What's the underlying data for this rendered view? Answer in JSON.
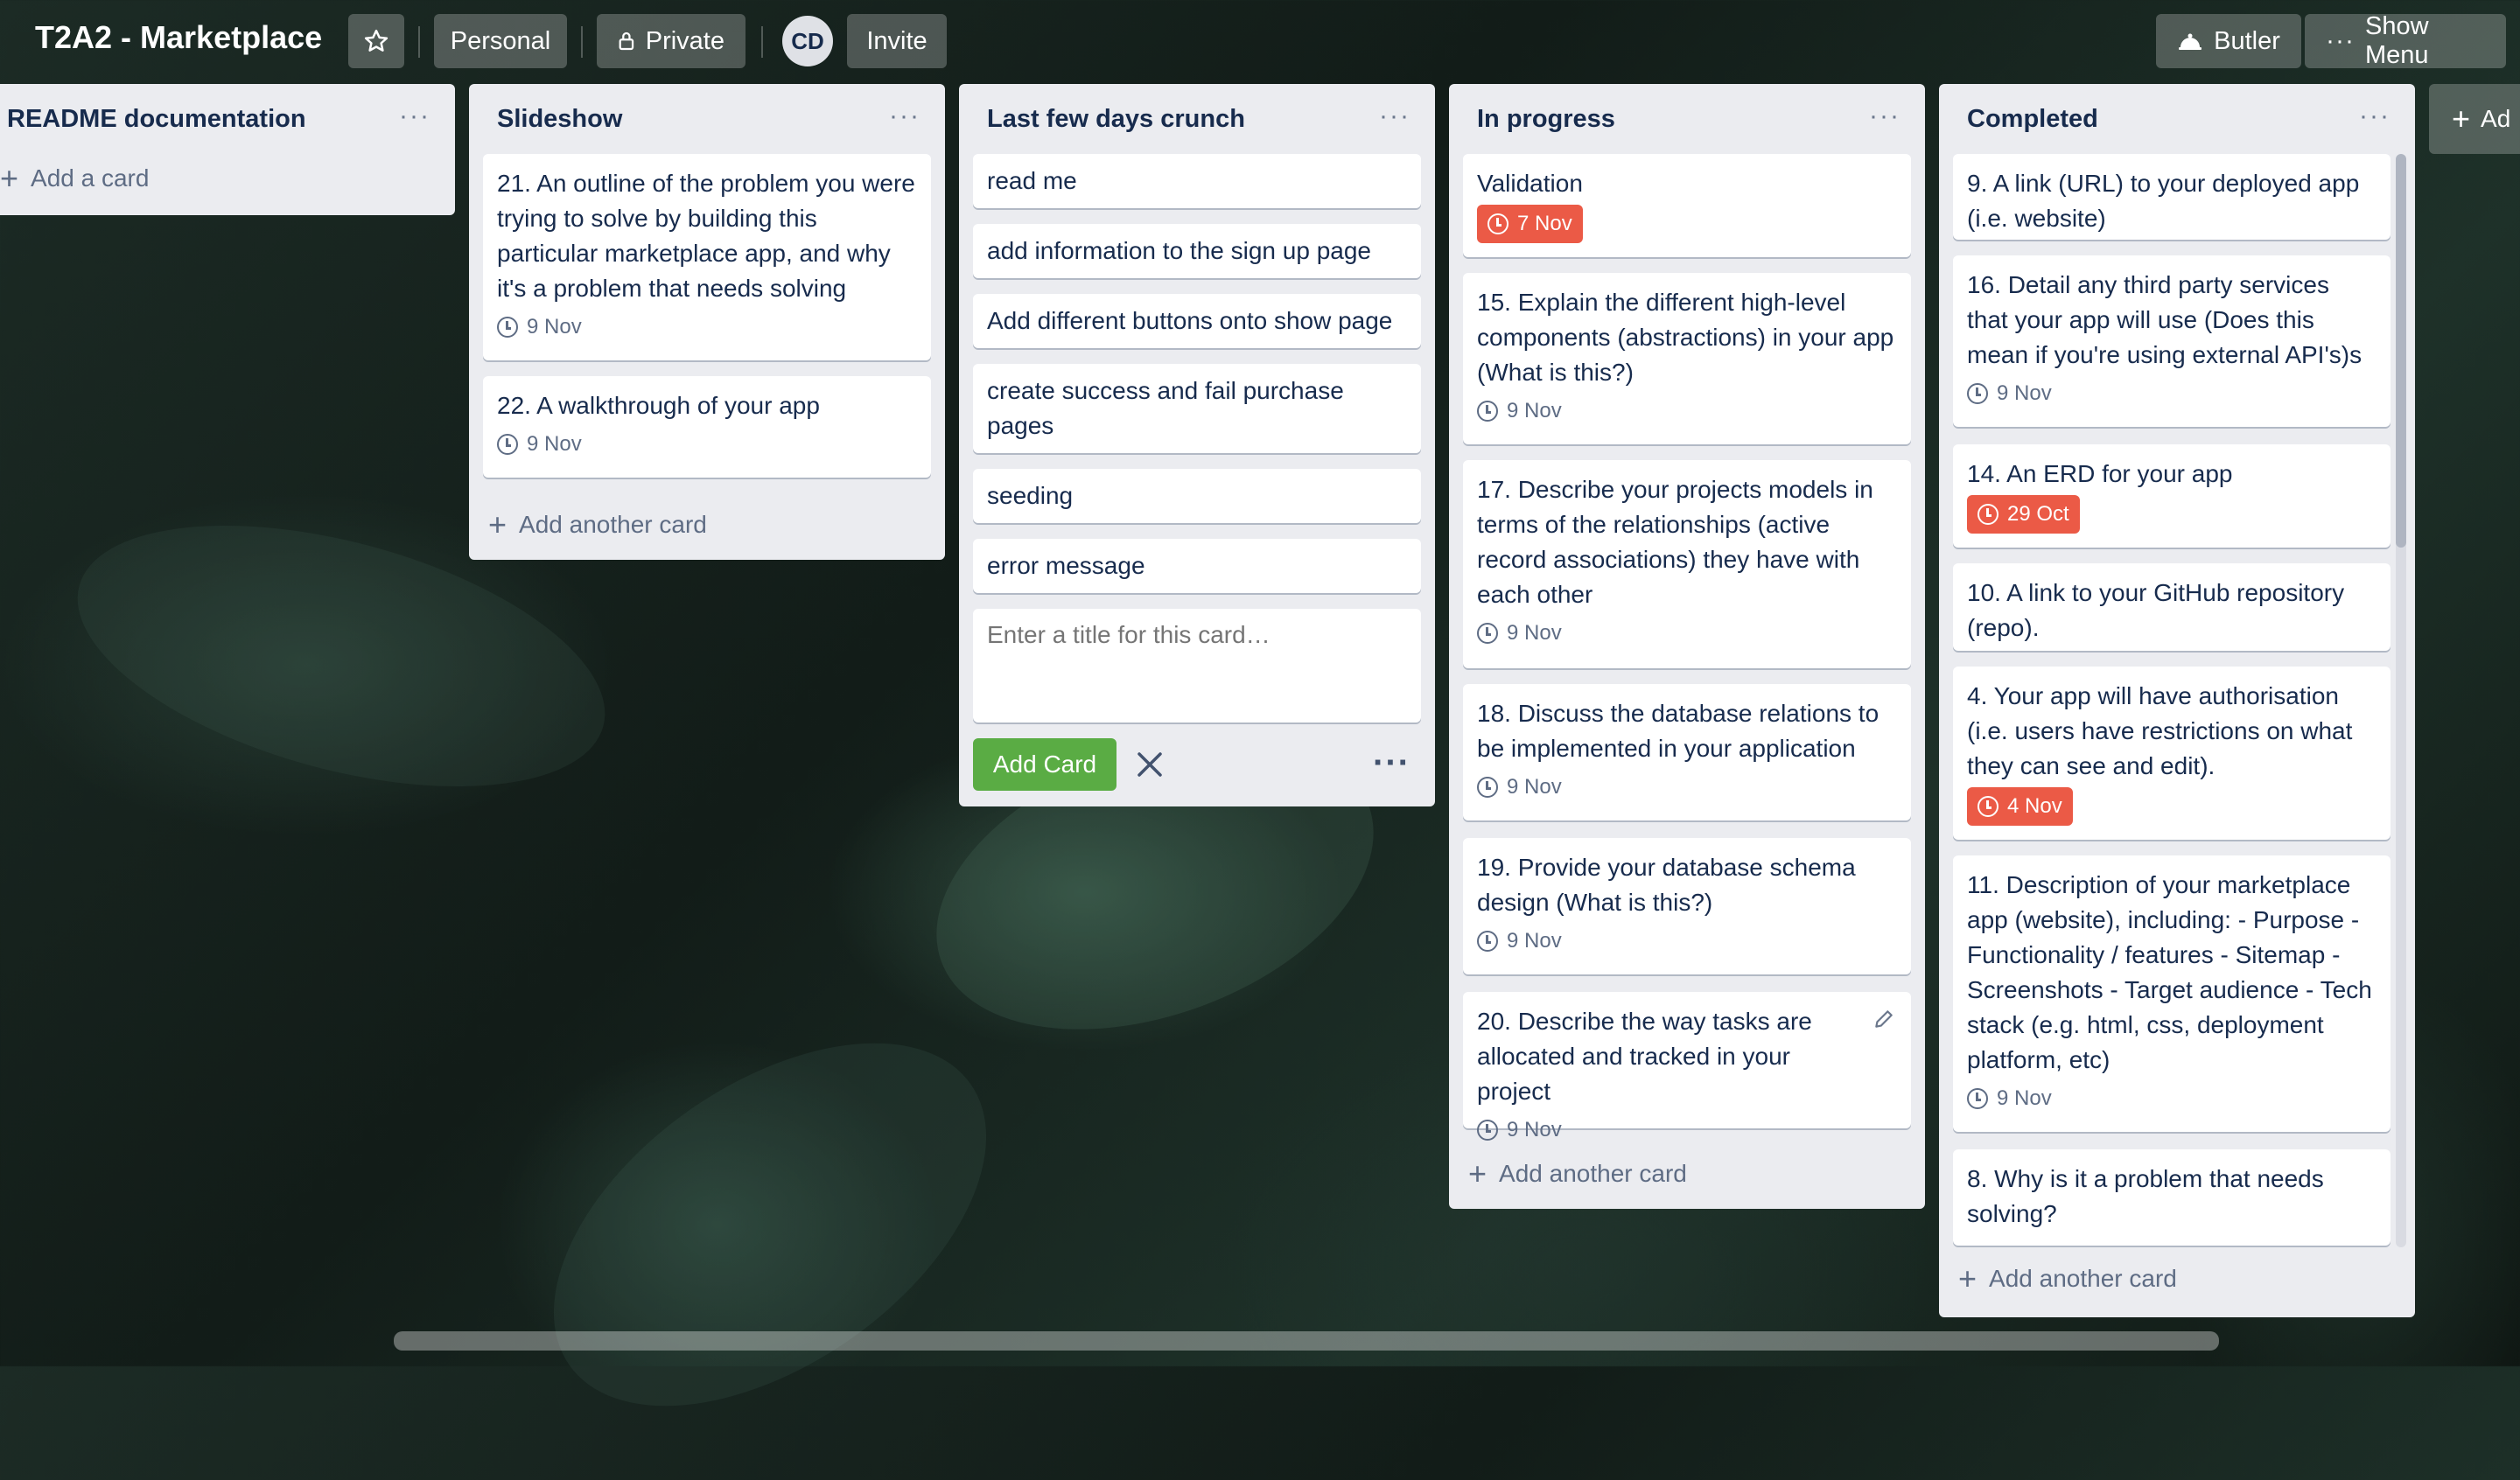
{
  "header": {
    "board_title": "T2A2 - Marketplace",
    "star_icon": "star-icon",
    "personal_label": "Personal",
    "private_label": "Private",
    "avatar_initials": "CD",
    "invite_label": "Invite",
    "butler_label": "Butler",
    "show_menu_label": "Show Menu",
    "add_list_label": "Ad"
  },
  "lists": [
    {
      "title": "README documentation",
      "cards": [],
      "add_label": "Add a card"
    },
    {
      "title": "Slideshow",
      "cards": [
        {
          "title": "21. An outline of the problem you were trying to solve by building this particular marketplace app, and why it's a problem that needs solving",
          "due": "9 Nov"
        },
        {
          "title": "22. A walkthrough of your app",
          "due": "9 Nov"
        }
      ],
      "add_label": "Add another card"
    },
    {
      "title": "Last few days crunch",
      "cards": [
        {
          "title": "read me"
        },
        {
          "title": "add information to the sign up page"
        },
        {
          "title": "Add different buttons onto show page"
        },
        {
          "title": "create success and fail purchase pages"
        },
        {
          "title": "seeding"
        },
        {
          "title": "error message"
        }
      ],
      "composer_placeholder": "Enter a title for this card…",
      "add_card_button": "Add Card"
    },
    {
      "title": "In progress",
      "cards": [
        {
          "title": "Validation",
          "due": "7 Nov"
        },
        {
          "title": "15. Explain the different high-level components (abstractions) in your app (What is this?)",
          "due": "9 Nov"
        },
        {
          "title": "17. Describe your projects models in terms of the relationships (active record associations) they have with each other",
          "due": "9 Nov"
        },
        {
          "title": "18. Discuss the database relations to be implemented in your application",
          "due": "9 Nov"
        },
        {
          "title": "19. Provide your database schema design (What is this?)",
          "due": "9 Nov"
        },
        {
          "title": "20. Describe the way tasks are allocated and tracked in your project",
          "due": "9 Nov"
        }
      ],
      "add_label": "Add another card"
    },
    {
      "title": "Completed",
      "cards": [
        {
          "title": "9. A link (URL) to your deployed app (i.e. website)"
        },
        {
          "title": "16. Detail any third party services that your app will use (Does this mean if you're using external API's)s",
          "due": "9 Nov"
        },
        {
          "title": "14. An ERD for your app",
          "due": "29 Oct"
        },
        {
          "title": "10. A link to your GitHub repository (repo)."
        },
        {
          "title": "4. Your app will have authorisation (i.e. users have restrictions on what they can see and edit).",
          "due": "4 Nov"
        },
        {
          "title": "11. Description of your marketplace app (website), including: - Purpose - Functionality / features - Sitemap - Screenshots - Target audience - Tech stack (e.g. html, css, deployment platform, etc)",
          "due": "9 Nov"
        },
        {
          "title": "8. Why is it a problem that needs solving?"
        }
      ],
      "add_label": "Add another card"
    }
  ],
  "colors": {
    "list_bg": "#ebecf0",
    "overdue_badge": "#eb5a46",
    "add_button": "#5aac44"
  }
}
